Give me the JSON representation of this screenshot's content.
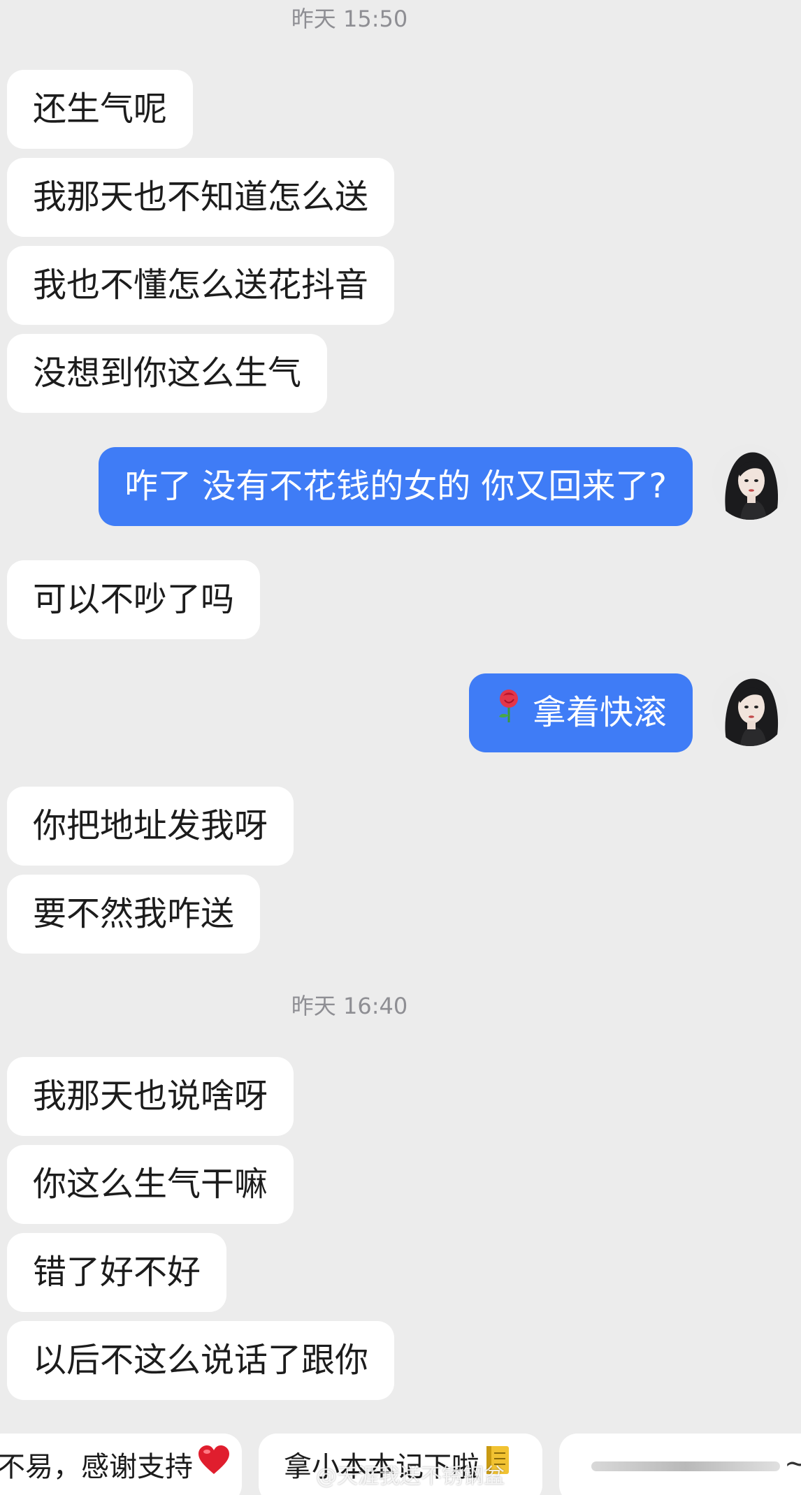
{
  "timestamps": [
    "昨天 15:50",
    "昨天 16:40"
  ],
  "messages": [
    {
      "side": "received",
      "text": "还生气呢"
    },
    {
      "side": "received",
      "text": "我那天也不知道怎么送"
    },
    {
      "side": "received",
      "text": "我也不懂怎么送花抖音"
    },
    {
      "side": "received",
      "text": "没想到你这么生气"
    },
    {
      "side": "sent",
      "text": "咋了 没有不花钱的女的 你又回来了?"
    },
    {
      "side": "received",
      "text": "可以不吵了吗"
    },
    {
      "side": "sent",
      "text": "拿着快滚",
      "icon": "rose-icon"
    },
    {
      "side": "received",
      "text": "你把地址发我呀"
    },
    {
      "side": "received",
      "text": "要不然我咋送"
    },
    {
      "side": "received",
      "text": "我那天也说啥呀"
    },
    {
      "side": "received",
      "text": "你这么生气干嘛"
    },
    {
      "side": "received",
      "text": "错了好不好"
    },
    {
      "side": "received",
      "text": "以后不这么说话了跟你"
    }
  ],
  "quick_replies": [
    {
      "text": "不易，感谢支持",
      "icon": "heart-icon"
    },
    {
      "text": "拿小本本记下啦",
      "icon": "notebook-icon"
    },
    {
      "text": ""
    }
  ],
  "watermark": "@天涯我送不锈钢盆",
  "tilde": "~",
  "colors": {
    "background": "#ececec",
    "received_bubble": "#ffffff",
    "sent_bubble": "#3f7cf6",
    "timestamp_text": "#8e8e93"
  }
}
